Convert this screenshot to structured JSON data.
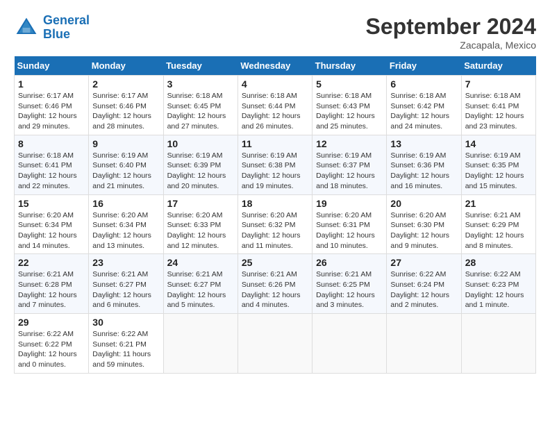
{
  "header": {
    "logo_line1": "General",
    "logo_line2": "Blue",
    "month": "September 2024",
    "location": "Zacapala, Mexico"
  },
  "days_of_week": [
    "Sunday",
    "Monday",
    "Tuesday",
    "Wednesday",
    "Thursday",
    "Friday",
    "Saturday"
  ],
  "weeks": [
    [
      {
        "num": "1",
        "rise": "6:17 AM",
        "set": "6:46 PM",
        "daylight": "12 hours and 29 minutes."
      },
      {
        "num": "2",
        "rise": "6:17 AM",
        "set": "6:46 PM",
        "daylight": "12 hours and 28 minutes."
      },
      {
        "num": "3",
        "rise": "6:18 AM",
        "set": "6:45 PM",
        "daylight": "12 hours and 27 minutes."
      },
      {
        "num": "4",
        "rise": "6:18 AM",
        "set": "6:44 PM",
        "daylight": "12 hours and 26 minutes."
      },
      {
        "num": "5",
        "rise": "6:18 AM",
        "set": "6:43 PM",
        "daylight": "12 hours and 25 minutes."
      },
      {
        "num": "6",
        "rise": "6:18 AM",
        "set": "6:42 PM",
        "daylight": "12 hours and 24 minutes."
      },
      {
        "num": "7",
        "rise": "6:18 AM",
        "set": "6:41 PM",
        "daylight": "12 hours and 23 minutes."
      }
    ],
    [
      {
        "num": "8",
        "rise": "6:18 AM",
        "set": "6:41 PM",
        "daylight": "12 hours and 22 minutes."
      },
      {
        "num": "9",
        "rise": "6:19 AM",
        "set": "6:40 PM",
        "daylight": "12 hours and 21 minutes."
      },
      {
        "num": "10",
        "rise": "6:19 AM",
        "set": "6:39 PM",
        "daylight": "12 hours and 20 minutes."
      },
      {
        "num": "11",
        "rise": "6:19 AM",
        "set": "6:38 PM",
        "daylight": "12 hours and 19 minutes."
      },
      {
        "num": "12",
        "rise": "6:19 AM",
        "set": "6:37 PM",
        "daylight": "12 hours and 18 minutes."
      },
      {
        "num": "13",
        "rise": "6:19 AM",
        "set": "6:36 PM",
        "daylight": "12 hours and 16 minutes."
      },
      {
        "num": "14",
        "rise": "6:19 AM",
        "set": "6:35 PM",
        "daylight": "12 hours and 15 minutes."
      }
    ],
    [
      {
        "num": "15",
        "rise": "6:20 AM",
        "set": "6:34 PM",
        "daylight": "12 hours and 14 minutes."
      },
      {
        "num": "16",
        "rise": "6:20 AM",
        "set": "6:34 PM",
        "daylight": "12 hours and 13 minutes."
      },
      {
        "num": "17",
        "rise": "6:20 AM",
        "set": "6:33 PM",
        "daylight": "12 hours and 12 minutes."
      },
      {
        "num": "18",
        "rise": "6:20 AM",
        "set": "6:32 PM",
        "daylight": "12 hours and 11 minutes."
      },
      {
        "num": "19",
        "rise": "6:20 AM",
        "set": "6:31 PM",
        "daylight": "12 hours and 10 minutes."
      },
      {
        "num": "20",
        "rise": "6:20 AM",
        "set": "6:30 PM",
        "daylight": "12 hours and 9 minutes."
      },
      {
        "num": "21",
        "rise": "6:21 AM",
        "set": "6:29 PM",
        "daylight": "12 hours and 8 minutes."
      }
    ],
    [
      {
        "num": "22",
        "rise": "6:21 AM",
        "set": "6:28 PM",
        "daylight": "12 hours and 7 minutes."
      },
      {
        "num": "23",
        "rise": "6:21 AM",
        "set": "6:27 PM",
        "daylight": "12 hours and 6 minutes."
      },
      {
        "num": "24",
        "rise": "6:21 AM",
        "set": "6:27 PM",
        "daylight": "12 hours and 5 minutes."
      },
      {
        "num": "25",
        "rise": "6:21 AM",
        "set": "6:26 PM",
        "daylight": "12 hours and 4 minutes."
      },
      {
        "num": "26",
        "rise": "6:21 AM",
        "set": "6:25 PM",
        "daylight": "12 hours and 3 minutes."
      },
      {
        "num": "27",
        "rise": "6:22 AM",
        "set": "6:24 PM",
        "daylight": "12 hours and 2 minutes."
      },
      {
        "num": "28",
        "rise": "6:22 AM",
        "set": "6:23 PM",
        "daylight": "12 hours and 1 minute."
      }
    ],
    [
      {
        "num": "29",
        "rise": "6:22 AM",
        "set": "6:22 PM",
        "daylight": "12 hours and 0 minutes."
      },
      {
        "num": "30",
        "rise": "6:22 AM",
        "set": "6:21 PM",
        "daylight": "11 hours and 59 minutes."
      },
      null,
      null,
      null,
      null,
      null
    ]
  ]
}
